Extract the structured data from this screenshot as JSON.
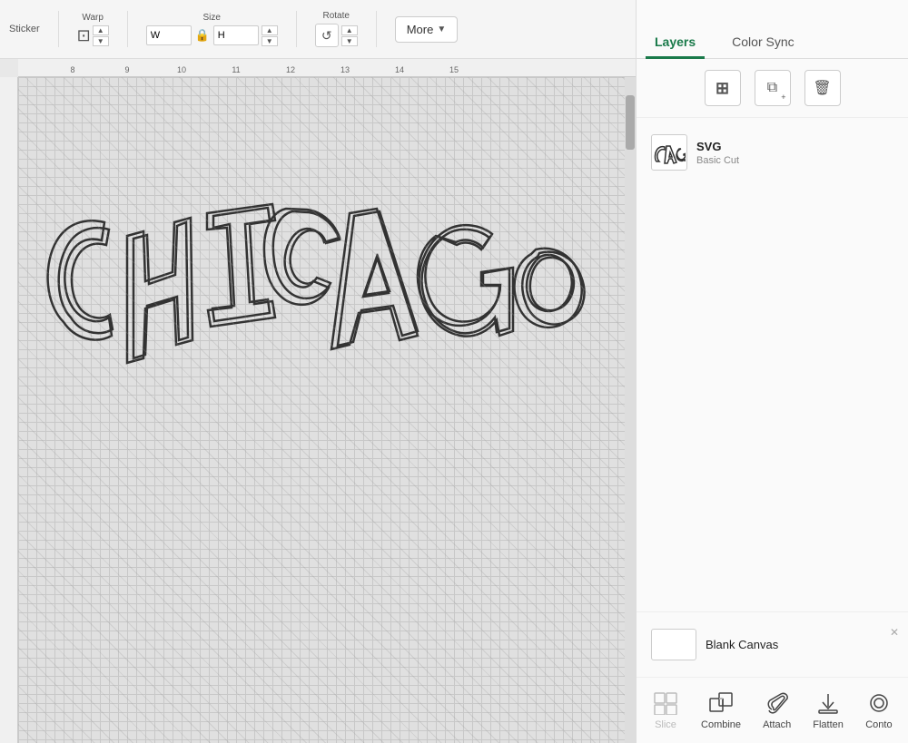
{
  "toolbar": {
    "sticker_label": "Sticker",
    "warp_label": "Warp",
    "size_label": "Size",
    "rotate_label": "Rotate",
    "more_label": "More",
    "width_value": "W",
    "height_value": "H"
  },
  "tabs": {
    "layers_label": "Layers",
    "color_sync_label": "Color Sync"
  },
  "panel_actions": {
    "add_icon": "＋",
    "copy_icon": "⧉",
    "delete_icon": "🗑"
  },
  "layers": [
    {
      "title": "SVG",
      "subtitle": "Basic Cut"
    }
  ],
  "blank_canvas": {
    "label": "Blank Canvas"
  },
  "bottom_actions": [
    {
      "label": "Slice",
      "icon": "⊟",
      "disabled": true
    },
    {
      "label": "Combine",
      "icon": "⊞",
      "disabled": false
    },
    {
      "label": "Attach",
      "icon": "🔗",
      "disabled": false
    },
    {
      "label": "Flatten",
      "icon": "⬇",
      "disabled": false
    },
    {
      "label": "Conto",
      "icon": "◎",
      "disabled": false
    }
  ],
  "ruler": {
    "marks": [
      "8",
      "9",
      "10",
      "11",
      "12",
      "13",
      "14",
      "15"
    ]
  },
  "colors": {
    "accent": "#1a7a4a",
    "tab_active": "#1a7a4a",
    "border": "#cccccc",
    "canvas_bg": "#e0e0e0",
    "grid_line": "#c8c8c8"
  }
}
